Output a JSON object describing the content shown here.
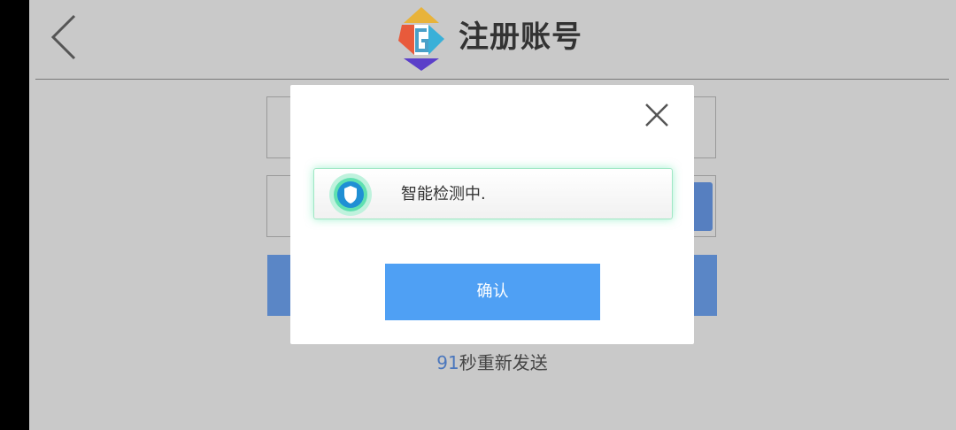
{
  "header": {
    "title": "注册账号",
    "back_icon": "chevron-left-icon",
    "logo_icon": "app-logo-icon"
  },
  "form": {
    "resend_countdown": "91",
    "resend_suffix": "秒重新发送"
  },
  "dialog": {
    "close_icon": "close-icon",
    "detect_icon": "shield-icon",
    "detect_text": "智能检测中.",
    "confirm_label": "确认"
  },
  "colors": {
    "accent_blue": "#4fa0f4",
    "dim_blue": "#5a86c6",
    "countdown_blue": "#4b77bd",
    "shield_green": "#5fe0b0",
    "shield_blue": "#1f8fd4"
  }
}
